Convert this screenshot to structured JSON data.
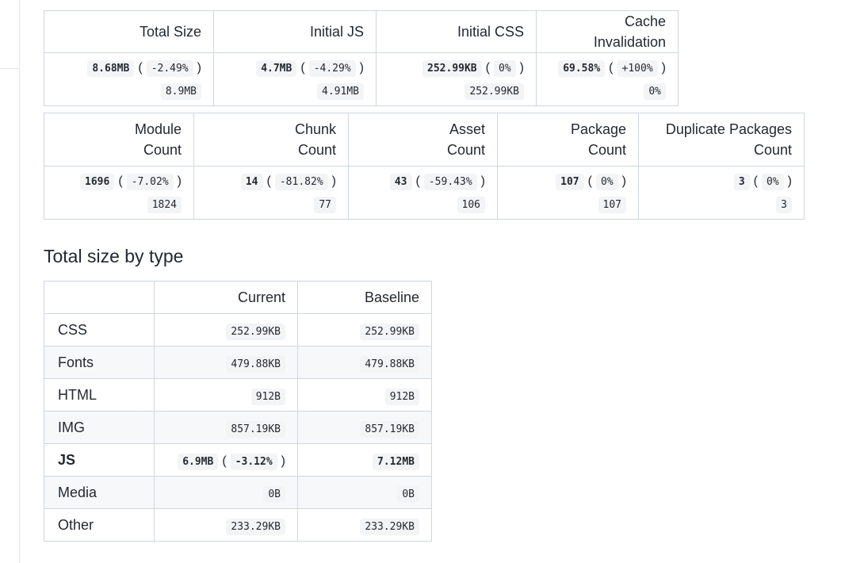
{
  "summary": {
    "headers": [
      "Total Size",
      "Initial JS",
      "Initial CSS",
      "Cache Invalidation"
    ],
    "cells": [
      {
        "current": "8.68MB",
        "delta": "-2.49%",
        "baseline": "8.9MB"
      },
      {
        "current": "4.7MB",
        "delta": "-4.29%",
        "baseline": "4.91MB"
      },
      {
        "current": "252.99KB",
        "delta": "0%",
        "baseline": "252.99KB"
      },
      {
        "current": "69.58%",
        "delta": "+100%",
        "baseline": "0%"
      }
    ]
  },
  "counts": {
    "headers": [
      [
        "Module",
        "Count"
      ],
      [
        "Chunk",
        "Count"
      ],
      [
        "Asset",
        "Count"
      ],
      [
        "Package",
        "Count"
      ],
      [
        "Duplicate Packages",
        "Count"
      ]
    ],
    "cells": [
      {
        "current": "1696",
        "delta": "-7.02%",
        "baseline": "1824"
      },
      {
        "current": "14",
        "delta": "-81.82%",
        "baseline": "77"
      },
      {
        "current": "43",
        "delta": "-59.43%",
        "baseline": "106"
      },
      {
        "current": "107",
        "delta": "0%",
        "baseline": "107"
      },
      {
        "current": "3",
        "delta": "0%",
        "baseline": "3"
      }
    ]
  },
  "by_type": {
    "title": "Total size by type",
    "headers": [
      "",
      "Current",
      "Baseline"
    ],
    "rows": [
      {
        "type": "CSS",
        "current": "252.99KB",
        "delta": "",
        "baseline": "252.99KB",
        "bold": false
      },
      {
        "type": "Fonts",
        "current": "479.88KB",
        "delta": "",
        "baseline": "479.88KB",
        "bold": false
      },
      {
        "type": "HTML",
        "current": "912B",
        "delta": "",
        "baseline": "912B",
        "bold": false
      },
      {
        "type": "IMG",
        "current": "857.19KB",
        "delta": "",
        "baseline": "857.19KB",
        "bold": false
      },
      {
        "type": "JS",
        "current": "6.9MB",
        "delta": "-3.12%",
        "baseline": "7.12MB",
        "bold": true
      },
      {
        "type": "Media",
        "current": "0B",
        "delta": "",
        "baseline": "0B",
        "bold": false
      },
      {
        "type": "Other",
        "current": "233.29KB",
        "delta": "",
        "baseline": "233.29KB",
        "bold": false
      }
    ]
  }
}
